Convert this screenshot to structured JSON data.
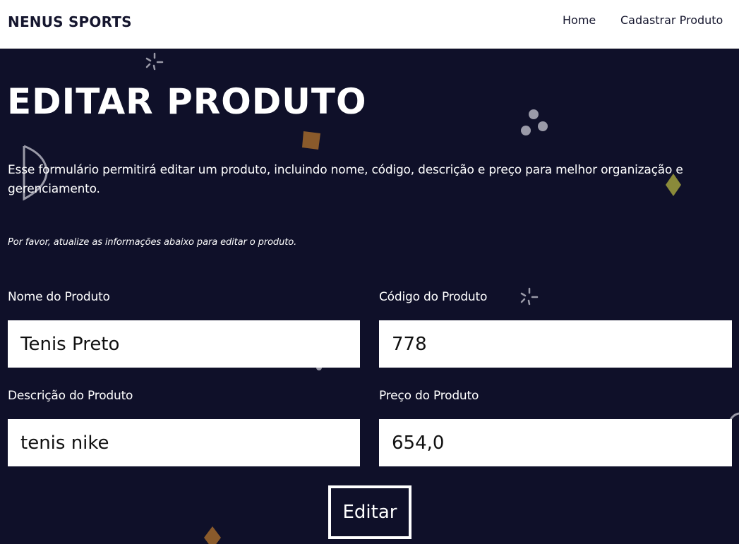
{
  "navbar": {
    "brand": "NENUS SPORTS",
    "links": [
      {
        "label": "Home"
      },
      {
        "label": "Cadastrar Produto"
      }
    ]
  },
  "main": {
    "title": "EDITAR PRODUTO",
    "description": "Esse formulário permitirá editar um produto, incluindo nome, código, descrição e preço para melhor organização e gerenciamento.",
    "instruction": "Por favor, atualize as informações abaixo para editar o produto."
  },
  "form": {
    "nome": {
      "label": "Nome do Produto",
      "value": "Tenis Preto"
    },
    "codigo": {
      "label": "Código do Produto",
      "value": "778"
    },
    "descricao": {
      "label": "Descrição do Produto",
      "value": "tenis nike"
    },
    "preco": {
      "label": "Preço do Produto",
      "value": "654,0"
    },
    "submit_label": "Editar"
  },
  "colors": {
    "background": "#0f1029",
    "navbar": "#ffffff",
    "text_light": "#ffffff",
    "confetti_brown": "#8a5a2b",
    "confetti_olive": "#8a8a3a",
    "confetti_gray": "#9a9aa8"
  }
}
